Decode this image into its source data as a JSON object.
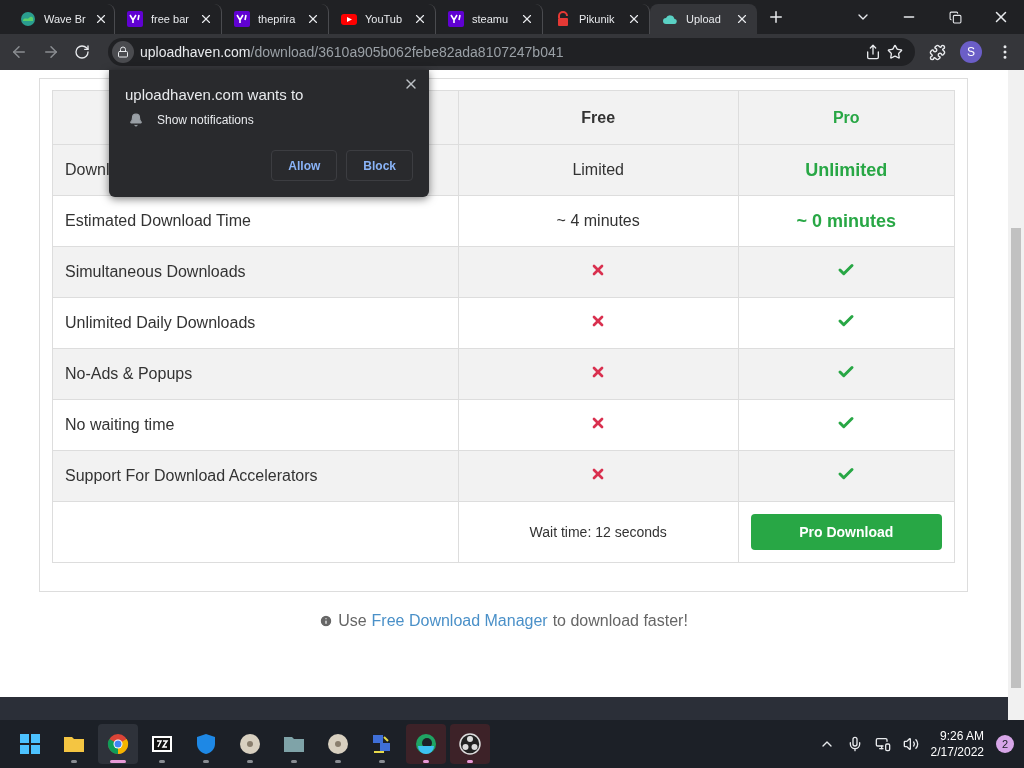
{
  "browser": {
    "tabs": [
      {
        "title": "Wave Br",
        "kind": "wave",
        "selected": false
      },
      {
        "title": "free bar",
        "kind": "yahoo",
        "selected": false
      },
      {
        "title": "theprira",
        "kind": "yahoo",
        "selected": false
      },
      {
        "title": "YouTub",
        "kind": "youtube",
        "selected": false
      },
      {
        "title": "steamu",
        "kind": "yahoo",
        "selected": false
      },
      {
        "title": "Pikunik",
        "kind": "lock",
        "selected": false
      },
      {
        "title": "Upload",
        "kind": "cloud",
        "selected": true
      }
    ],
    "address": {
      "host": "uploadhaven.com",
      "path": "/download/3610a905b062febe82ada8107247b041"
    },
    "profile": "S"
  },
  "permission_popup": {
    "title": "uploadhaven.com wants to",
    "permission": "Show notifications",
    "buttons": [
      "Allow",
      "Block"
    ]
  },
  "table": {
    "columns": [
      "Free",
      "Pro"
    ],
    "rows": [
      {
        "feature": "Downl",
        "kind": "text",
        "free": "Limited",
        "pro": "Unlimited"
      },
      {
        "feature": "Estimated Download Time",
        "kind": "text",
        "free": "~ 4 minutes",
        "pro": "~ 0 minutes"
      },
      {
        "feature": "Simultaneous Downloads",
        "kind": "mark",
        "free": false,
        "pro": true
      },
      {
        "feature": "Unlimited Daily Downloads",
        "kind": "mark",
        "free": false,
        "pro": true
      },
      {
        "feature": "No-Ads & Popups",
        "kind": "mark",
        "free": false,
        "pro": true
      },
      {
        "feature": "No waiting time",
        "kind": "mark",
        "free": false,
        "pro": true
      },
      {
        "feature": "Support For Download Accelerators",
        "kind": "mark",
        "free": false,
        "pro": true
      }
    ],
    "wait": "Wait time: 12 seconds",
    "pro_button": "Pro Download"
  },
  "note": {
    "before": "Use",
    "link": "Free Download Manager",
    "after": "to download faster!"
  },
  "taskbar": {
    "apps": [
      {
        "kind": "start",
        "running": false,
        "selected": false,
        "flagged": false
      },
      {
        "kind": "folder",
        "running": true,
        "selected": false,
        "flagged": false
      },
      {
        "kind": "chrome",
        "running": true,
        "selected": true,
        "flagged": false
      },
      {
        "kind": "archiver",
        "running": true,
        "selected": false,
        "flagged": false
      },
      {
        "kind": "shield",
        "running": true,
        "selected": false,
        "flagged": false
      },
      {
        "kind": "disc",
        "running": true,
        "selected": false,
        "flagged": false
      },
      {
        "kind": "folder-grey",
        "running": true,
        "selected": false,
        "flagged": false
      },
      {
        "kind": "disc",
        "running": true,
        "selected": false,
        "flagged": false
      },
      {
        "kind": "network",
        "running": true,
        "selected": false,
        "flagged": false
      },
      {
        "kind": "edge",
        "running": true,
        "selected": false,
        "flagged": true
      },
      {
        "kind": "obs",
        "running": true,
        "selected": false,
        "flagged": true
      }
    ],
    "time": "9:26 AM",
    "date": "2/17/2022",
    "notifications": "2"
  }
}
